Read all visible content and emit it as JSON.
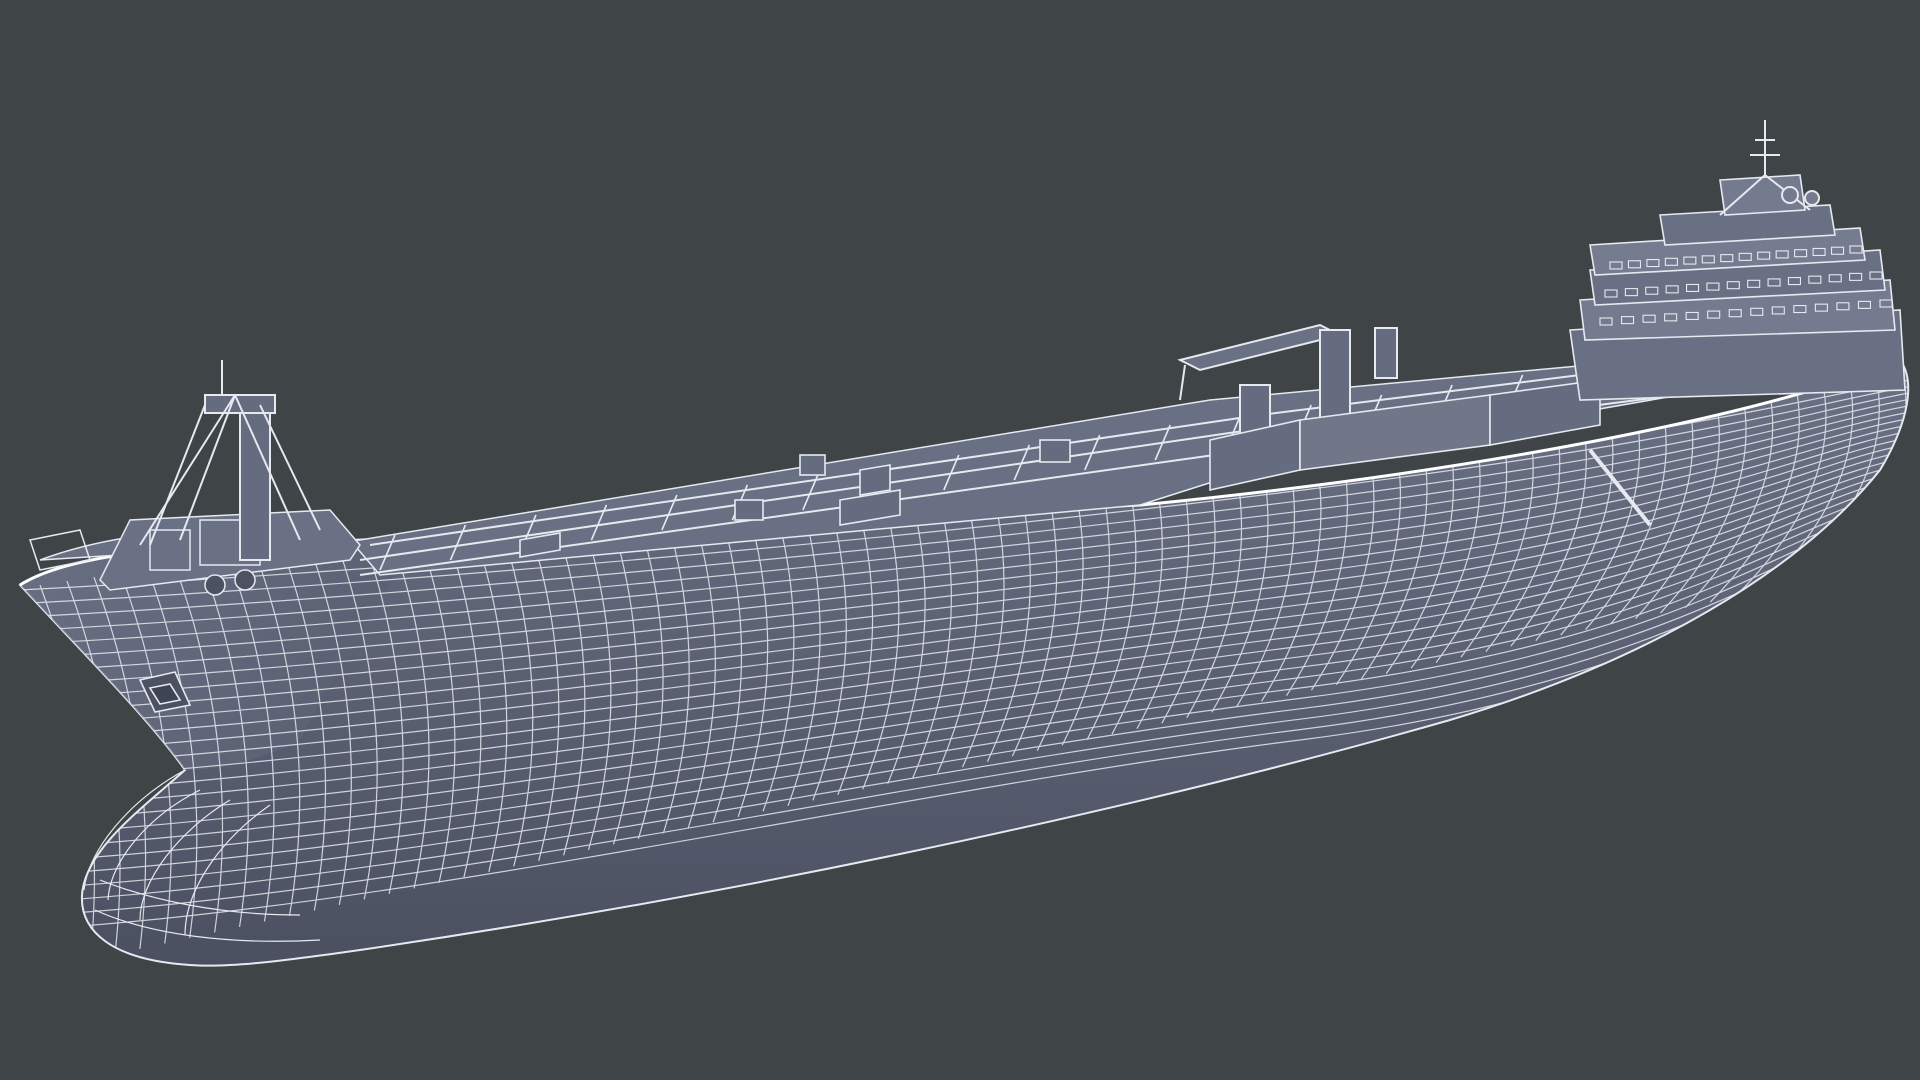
{
  "scene": {
    "subject": "ship-hull-wireframe",
    "colors": {
      "background": "#3f4447",
      "hull_fill": "#5b6173",
      "hull_shade": "#4c5162",
      "hull_light": "#737a8e",
      "wire": "#e6e9f0",
      "wire_dim": "#bfc4d0",
      "deck_fill": "#6a7083"
    }
  }
}
